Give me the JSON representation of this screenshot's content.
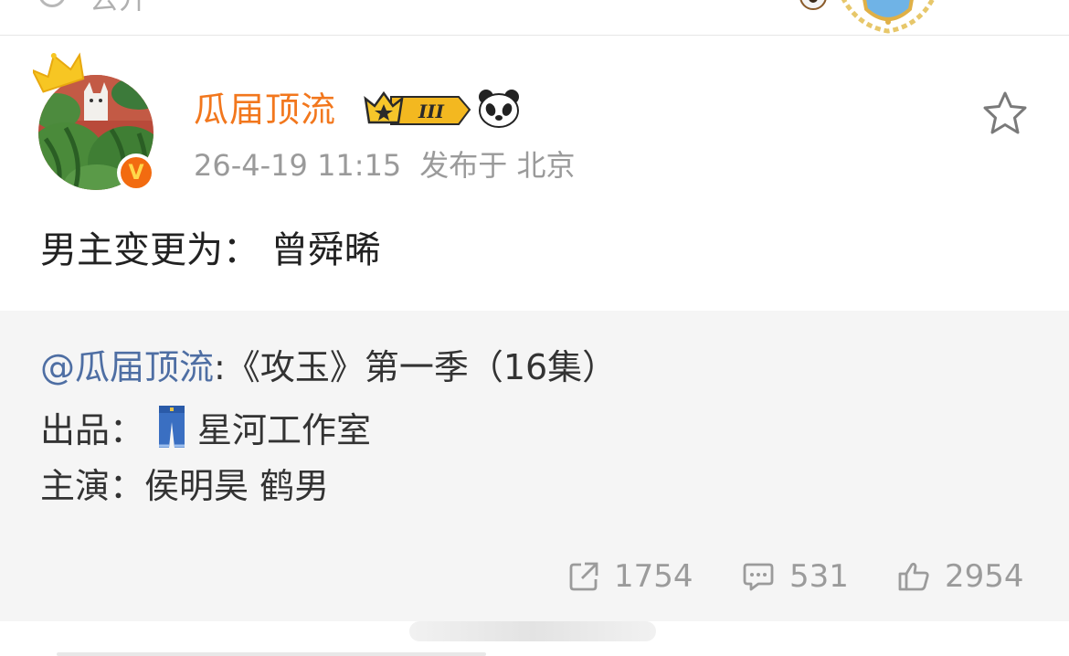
{
  "top_bar": {
    "text": "去开",
    "icons": [
      "circle-icon",
      "soccer-ball-icon",
      "shield-badge-icon"
    ]
  },
  "post": {
    "username": "瓜届顶流",
    "vip_level": "III",
    "timestamp": "26-4-19 11:15",
    "location": "发布于 北京",
    "text": "男主变更为： 曾舜晞",
    "icons": {
      "avatar_badge": "verified-v-icon",
      "favorite": "star-outline-icon",
      "emoji": "panda-icon",
      "crown": "crown-icon"
    }
  },
  "repost": {
    "mention": "@瓜届顶流",
    "line1_rest": ":《攻玉》第一季（16集）",
    "line2_label": "出品：",
    "line2_value": "星河工作室",
    "line3": "主演：侯明昊 鹤男"
  },
  "actions": {
    "repost_count": "1754",
    "comment_count": "531",
    "like_count": "2954"
  },
  "colors": {
    "username": "#f2771d",
    "mention": "#4e6ea3",
    "repost_background": "#f5f5f5",
    "meta_text": "#9a9a9a"
  }
}
